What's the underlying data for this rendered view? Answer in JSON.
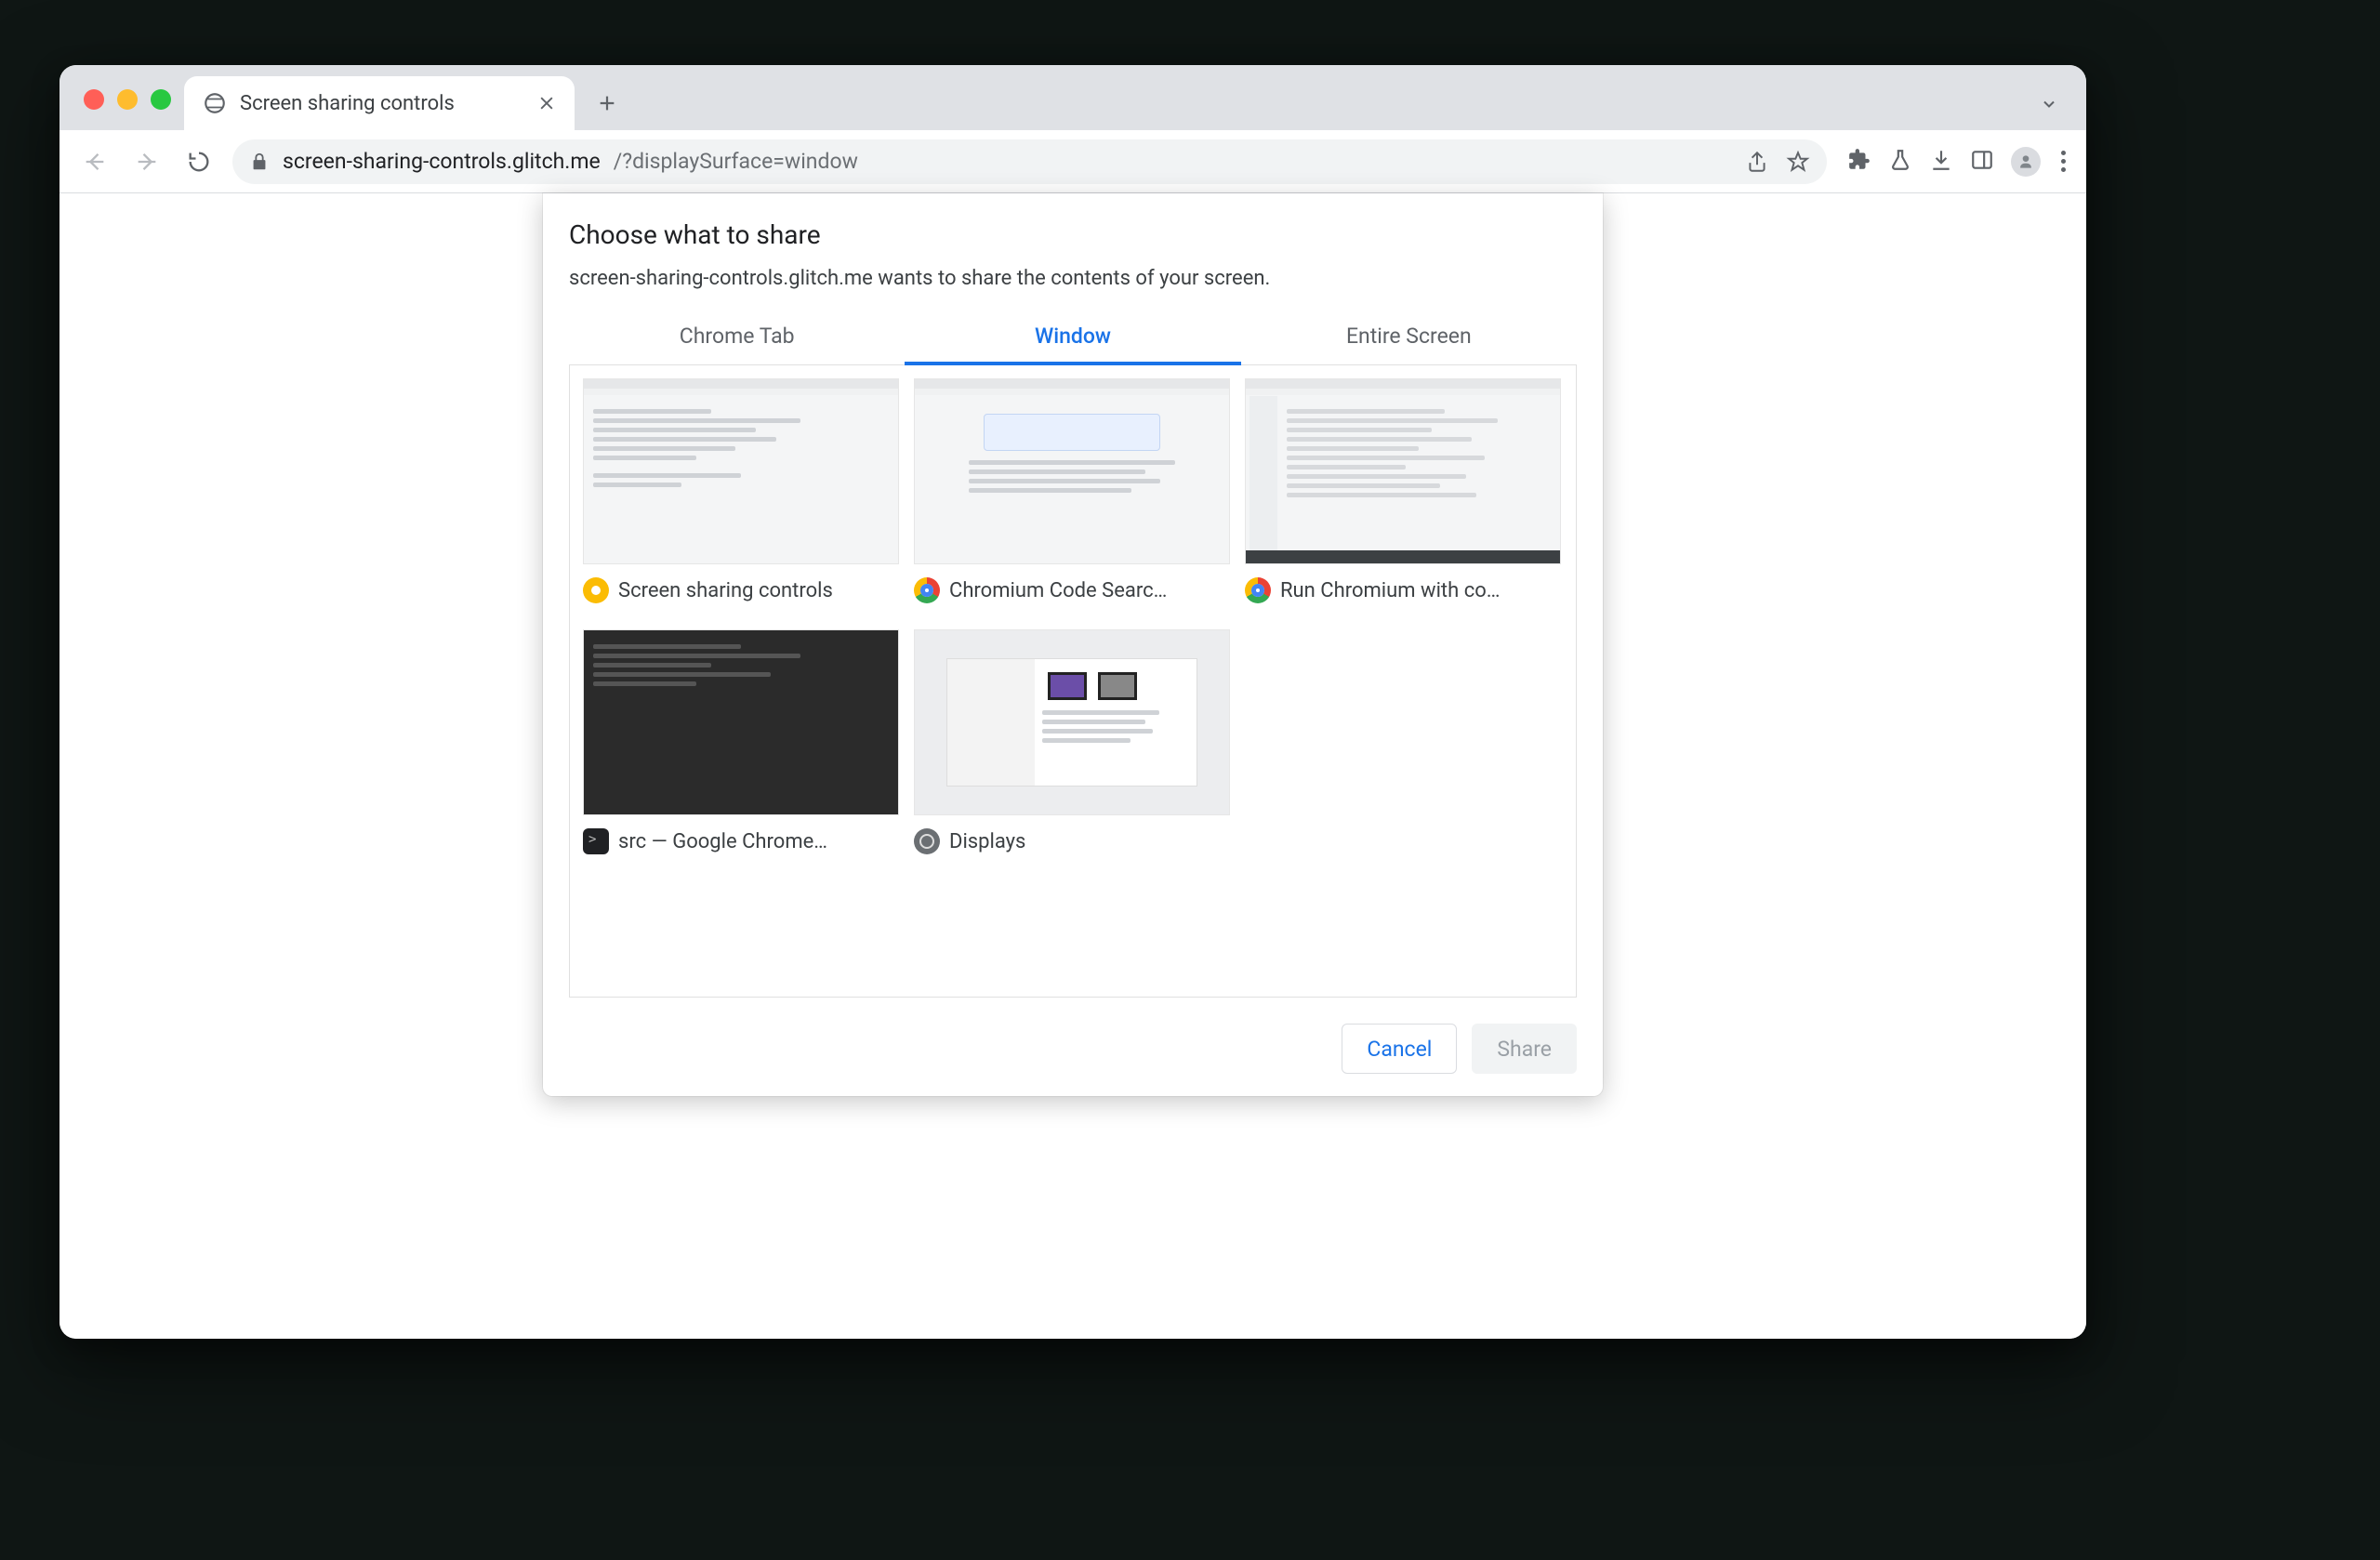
{
  "tab": {
    "title": "Screen sharing controls"
  },
  "omnibox": {
    "host": "screen-sharing-controls.glitch.me",
    "path": "/?displaySurface=window"
  },
  "dialog": {
    "title": "Choose what to share",
    "subtitle": "screen-sharing-controls.glitch.me wants to share the contents of your screen.",
    "tabs": {
      "chrome_tab": "Chrome Tab",
      "window": "Window",
      "entire_screen": "Entire Screen"
    },
    "active_tab": "window",
    "cancel": "Cancel",
    "share": "Share",
    "windows": [
      {
        "icon": "canary",
        "label": "Screen sharing controls"
      },
      {
        "icon": "chrome",
        "label": "Chromium Code Searc…"
      },
      {
        "icon": "chrome",
        "label": "Run Chromium with co…"
      },
      {
        "icon": "term",
        "label": "src — Google Chrome…"
      },
      {
        "icon": "sys",
        "label": "Displays"
      }
    ]
  }
}
